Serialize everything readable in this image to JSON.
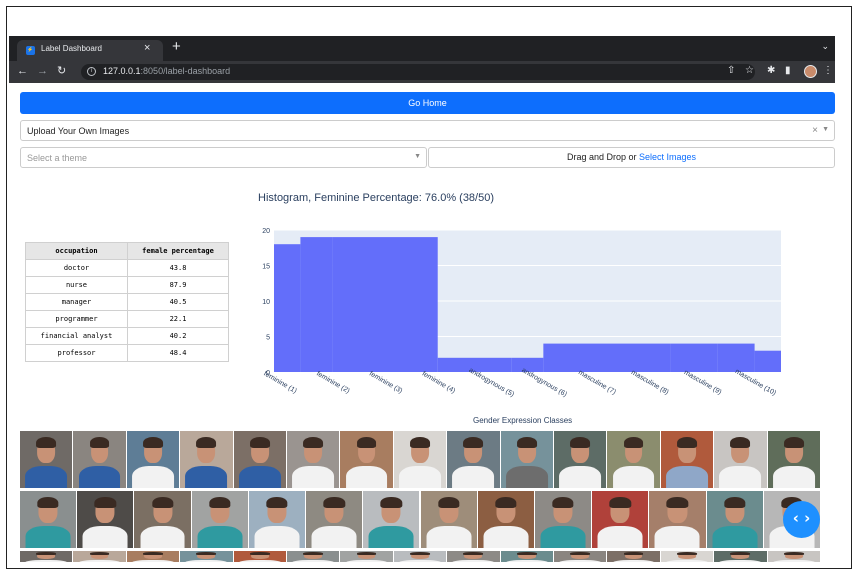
{
  "browser": {
    "tab_title": "Label Dashboard",
    "tab_favicon": "dash-favicon-icon",
    "url_host": "127.0.0.1",
    "url_rest": ":8050/label-dashboard",
    "icons": [
      "back-arrow-icon",
      "forward-arrow-icon",
      "reload-icon",
      "info-icon",
      "share-icon",
      "star-icon",
      "extensions-icon",
      "sidepanel-icon",
      "profile-avatar-icon",
      "kebab-menu-icon"
    ]
  },
  "app": {
    "go_home_label": "Go Home",
    "upload_select_value": "Upload Your Own Images",
    "theme_placeholder": "Select a theme",
    "dropzone_text": "Drag and Drop or ",
    "dropzone_link": "Select Images",
    "accent_color": "#0d6efd"
  },
  "table": {
    "headers": [
      "occupation",
      "female percentage"
    ],
    "rows": [
      [
        "doctor",
        "43.8"
      ],
      [
        "nurse",
        "87.9"
      ],
      [
        "manager",
        "40.5"
      ],
      [
        "programmer",
        "22.1"
      ],
      [
        "financial analyst",
        "40.2"
      ],
      [
        "professor",
        "48.4"
      ]
    ]
  },
  "chart_data": {
    "type": "bar",
    "title": "Histogram, Feminine Percentage: 76.0% (38/50)",
    "xlabel": "Gender Expression Classes",
    "ylabel": "",
    "categories": [
      "feminine (1)",
      "feminine (2)",
      "feminine (3)",
      "feminine (4)",
      "androgynous (5)",
      "androgynous (6)",
      "masculine (7)",
      "masculine (8)",
      "masculine (9)",
      "masculine (10)"
    ],
    "bins": [
      0.9,
      1.4,
      2.0,
      4.0,
      5.4,
      6.0,
      8.4,
      9.3,
      10.0,
      10.5
    ],
    "bin_values": [
      18,
      19,
      19,
      2,
      2,
      4,
      4,
      4,
      3
    ],
    "x_range": [
      0.9,
      10.5
    ],
    "yticks": [
      0,
      5,
      10,
      15,
      20
    ],
    "ylim": [
      0,
      20
    ],
    "bar_color": "#636efa",
    "grid": true
  },
  "gallery": {
    "row_count_visible": 2
  },
  "nav_fab_label": "‹ ›"
}
